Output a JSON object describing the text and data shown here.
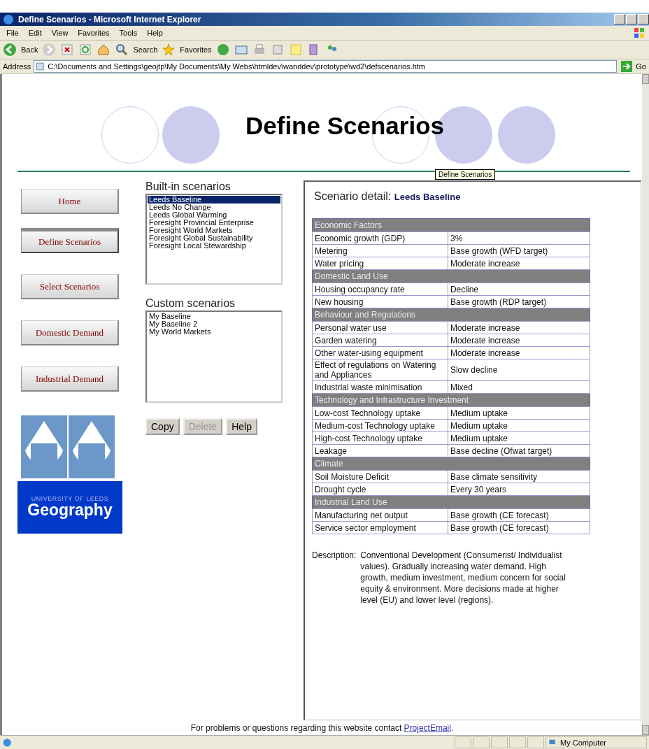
{
  "window": {
    "title": "Define Scenarios - Microsoft Internet Explorer"
  },
  "menu": [
    "File",
    "Edit",
    "View",
    "Favorites",
    "Tools",
    "Help"
  ],
  "toolbar": {
    "back": "Back",
    "search": "Search",
    "favorites": "Favorites"
  },
  "address": {
    "label": "Address",
    "value": "C:\\Documents and Settings\\geojtp\\My Documents\\My Webs\\htmldev\\wanddev\\prototype\\wd2\\defscenarios.htm",
    "go": "Go"
  },
  "header": {
    "title": "Define Scenarios",
    "tooltip": "Define Scenarios"
  },
  "nav": [
    {
      "label": "Home",
      "selected": false
    },
    {
      "label": "Define Scenarios",
      "selected": true
    },
    {
      "label": "Select Scenarios",
      "selected": false
    },
    {
      "label": "Domestic Demand",
      "selected": false
    },
    {
      "label": "Industrial Demand",
      "selected": false
    }
  ],
  "logo": {
    "small_text": "UNIVERSITY OF LEEDS",
    "text": "Geography"
  },
  "builtin": {
    "label": "Built-in scenarios",
    "items": [
      {
        "label": "Leeds Baseline",
        "selected": true
      },
      {
        "label": "Leeds No Change",
        "selected": false
      },
      {
        "label": "Leeds Global Warming",
        "selected": false
      },
      {
        "label": "Foresight Provincial Enterprise",
        "selected": false
      },
      {
        "label": "Foresight World Markets",
        "selected": false
      },
      {
        "label": "Foresight Global Sustainability",
        "selected": false
      },
      {
        "label": "Foresight Local Stewardship",
        "selected": false
      }
    ]
  },
  "custom": {
    "label": "Custom scenarios",
    "items": [
      {
        "label": "My Baseline",
        "selected": false
      },
      {
        "label": "My Baseline 2",
        "selected": false
      },
      {
        "label": "My World Markets",
        "selected": false
      }
    ]
  },
  "buttons": [
    {
      "label": "Copy",
      "disabled": false
    },
    {
      "label": "Delete",
      "disabled": true
    },
    {
      "label": "Help",
      "disabled": false
    }
  ],
  "detail": {
    "label": "Scenario detail:",
    "name": "Leeds Baseline",
    "sections": [
      {
        "title": "Economic Factors",
        "rows": [
          [
            "Economic growth (GDP)",
            "3%"
          ],
          [
            "Metering",
            "Base growth (WFD target)"
          ],
          [
            "Water pricing",
            "Moderate increase"
          ]
        ]
      },
      {
        "title": "Domestic Land Use",
        "rows": [
          [
            "Housing occupancy rate",
            "Decline"
          ],
          [
            "New housing",
            "Base growth (RDP target)"
          ]
        ]
      },
      {
        "title": "Behaviour and Regulations",
        "rows": [
          [
            "Personal water use",
            "Moderate increase"
          ],
          [
            "Garden watering",
            "Moderate increase"
          ],
          [
            "Other water-using equipment",
            "Moderate increase"
          ],
          [
            "Effect of regulations on Watering and Appliances",
            "Slow decline"
          ],
          [
            "Industrial waste minimisation",
            "Mixed"
          ]
        ]
      },
      {
        "title": "Technology and Infrastructure Investment",
        "rows": [
          [
            "Low-cost Technology uptake",
            "Medium uptake"
          ],
          [
            "Medium-cost Technology uptake",
            "Medium uptake"
          ],
          [
            "High-cost Technology uptake",
            "Medium uptake"
          ],
          [
            "Leakage",
            "Base decline (Ofwat target)"
          ]
        ]
      },
      {
        "title": "Climate",
        "rows": [
          [
            "Soil Moisture Deficit",
            "Base climate sensitivity"
          ],
          [
            "Drought cycle",
            "Every 30 years"
          ]
        ]
      },
      {
        "title": "Industrial Land Use",
        "rows": [
          [
            "Manufacturing net output",
            "Base growth (CE forecast)"
          ],
          [
            "Service sector employment",
            "Base growth (CE forecast)"
          ]
        ]
      }
    ],
    "description_label": "Description:",
    "description": "Conventional Development (Consumerist/ Individualist values). Gradually increasing water demand. High growth, medium investment, medium concern for social equity & environment. More decisions made at higher level (EU) and lower level (regions)."
  },
  "footer": {
    "text": "For problems or questions regarding this website contact",
    "link": "ProjectEmail",
    "end": "."
  },
  "status_bar": {
    "zone": "My Computer"
  }
}
